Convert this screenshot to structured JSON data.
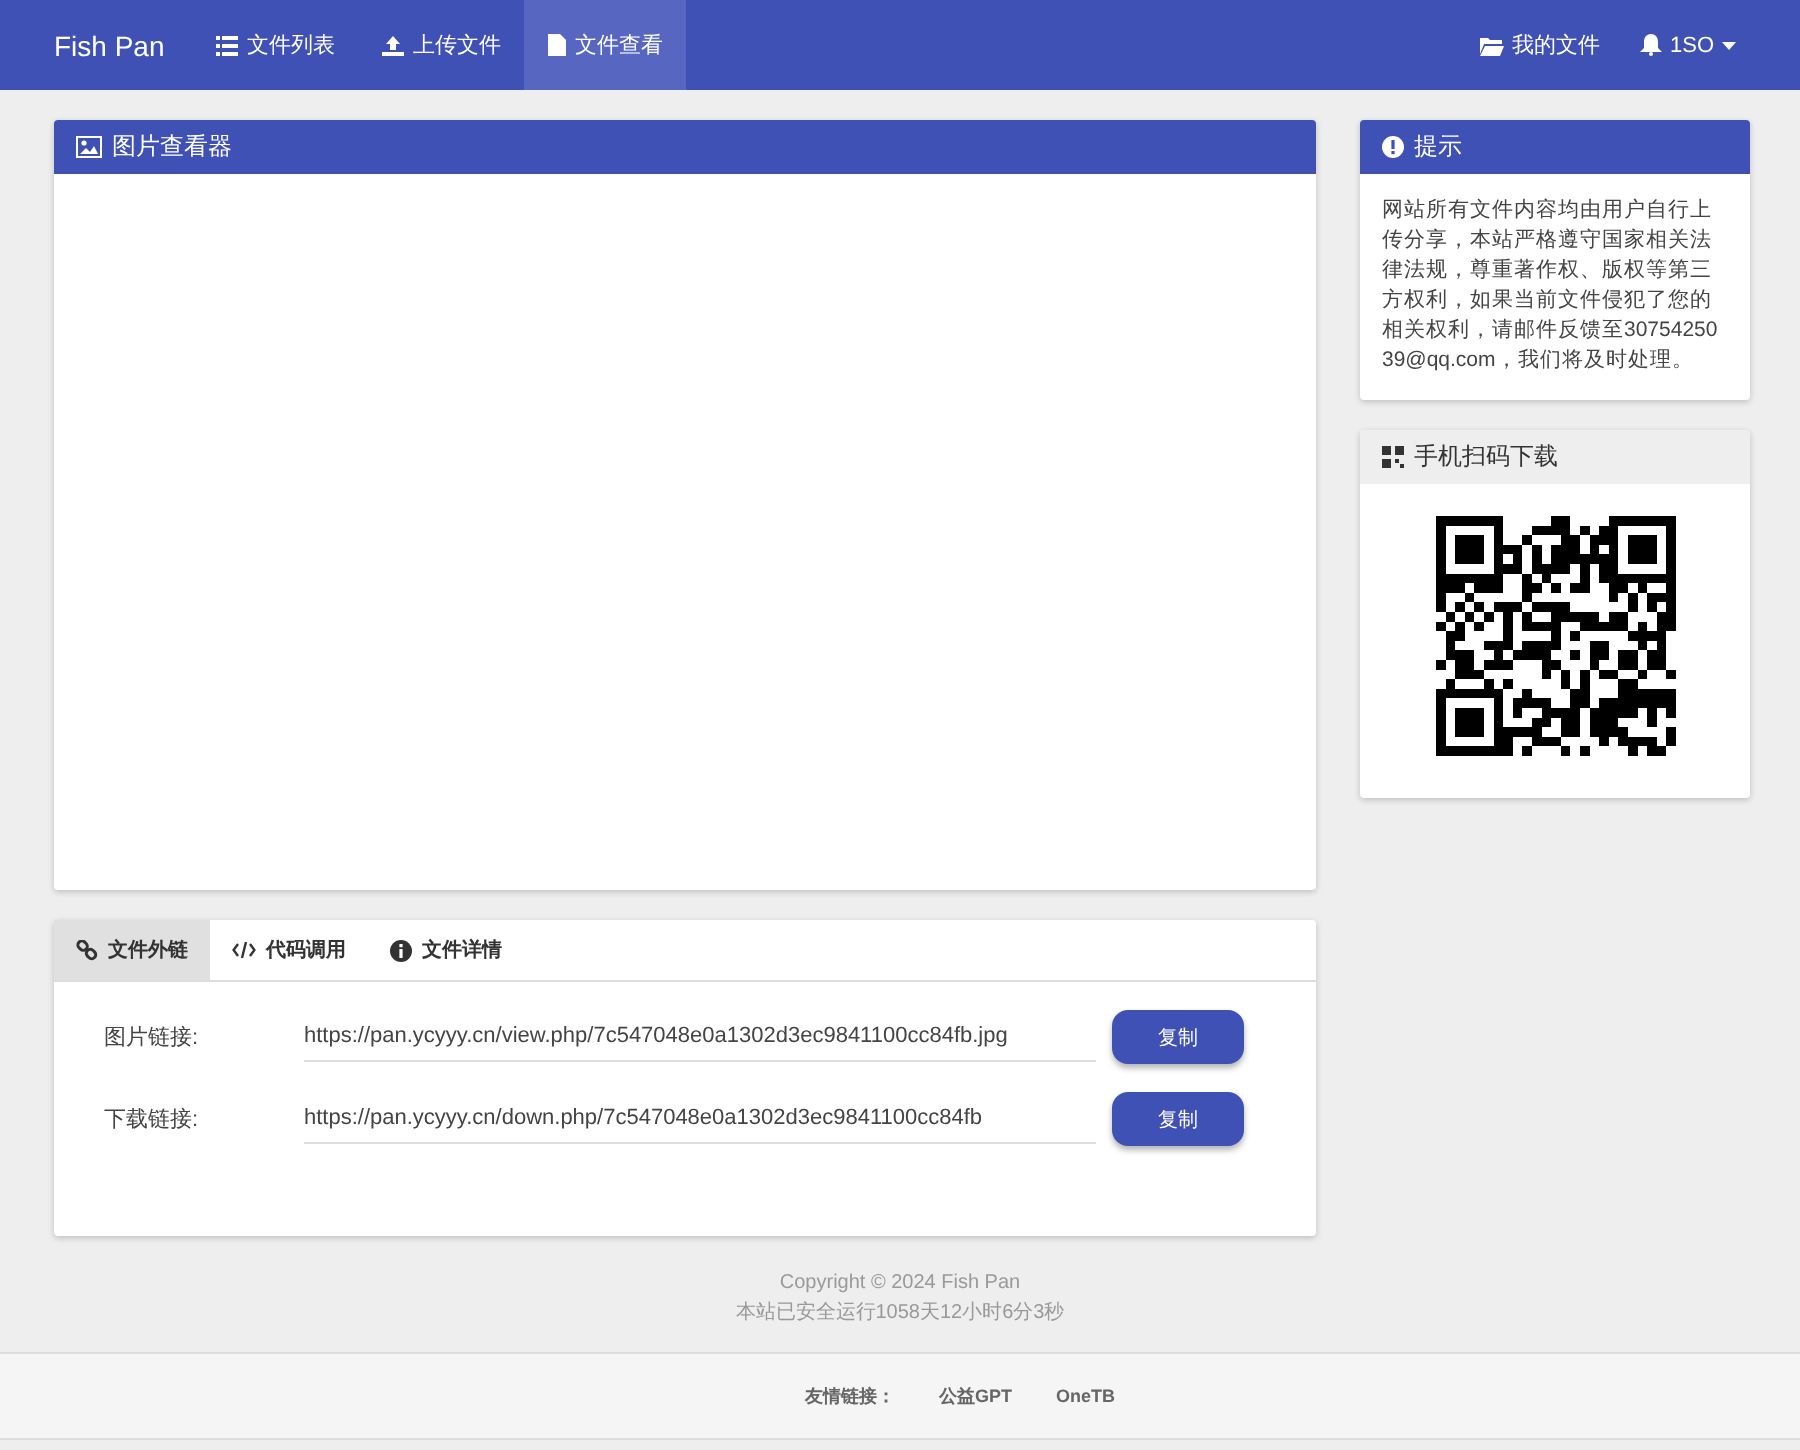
{
  "navbar": {
    "brand": "Fish Pan",
    "items": [
      {
        "kind": "list",
        "label": "文件列表",
        "selected": false
      },
      {
        "kind": "upload",
        "label": "上传文件",
        "selected": false
      },
      {
        "kind": "file",
        "label": "文件查看",
        "selected": true
      }
    ],
    "right": [
      {
        "kind": "folder",
        "label": "我的文件",
        "caret": false
      },
      {
        "kind": "bell",
        "label": "1SO",
        "caret": true
      }
    ]
  },
  "viewer": {
    "title": "图片查看器"
  },
  "tabs": [
    {
      "kind": "link",
      "label": "文件外链",
      "selected": true
    },
    {
      "kind": "code",
      "label": "代码调用",
      "selected": false
    },
    {
      "kind": "info",
      "label": "文件详情",
      "selected": false
    }
  ],
  "links": [
    {
      "label": "图片链接:",
      "value": "https://pan.ycyyy.cn/view.php/7c547048e0a1302d3ec9841100cc84fb.jpg",
      "button": "复制"
    },
    {
      "label": "下载链接:",
      "value": "https://pan.ycyyy.cn/down.php/7c547048e0a1302d3ec9841100cc84fb",
      "button": "复制"
    }
  ],
  "notice": {
    "title": "提示",
    "text": "网站所有文件内容均由用户自行上传分享，本站严格遵守国家相关法律法规，尊重著作权、版权等第三方权利，如果当前文件侵犯了您的相关权利，请邮件反馈至3075425039@qq.com，我们将及时处理。"
  },
  "qr": {
    "title": "手机扫码下载"
  },
  "footer": {
    "copyright": "Copyright © 2024 Fish Pan",
    "uptime": "本站已安全运行1058天12小时6分3秒",
    "links_label": "友情链接：",
    "links": [
      "公益GPT",
      "OneTB"
    ]
  }
}
